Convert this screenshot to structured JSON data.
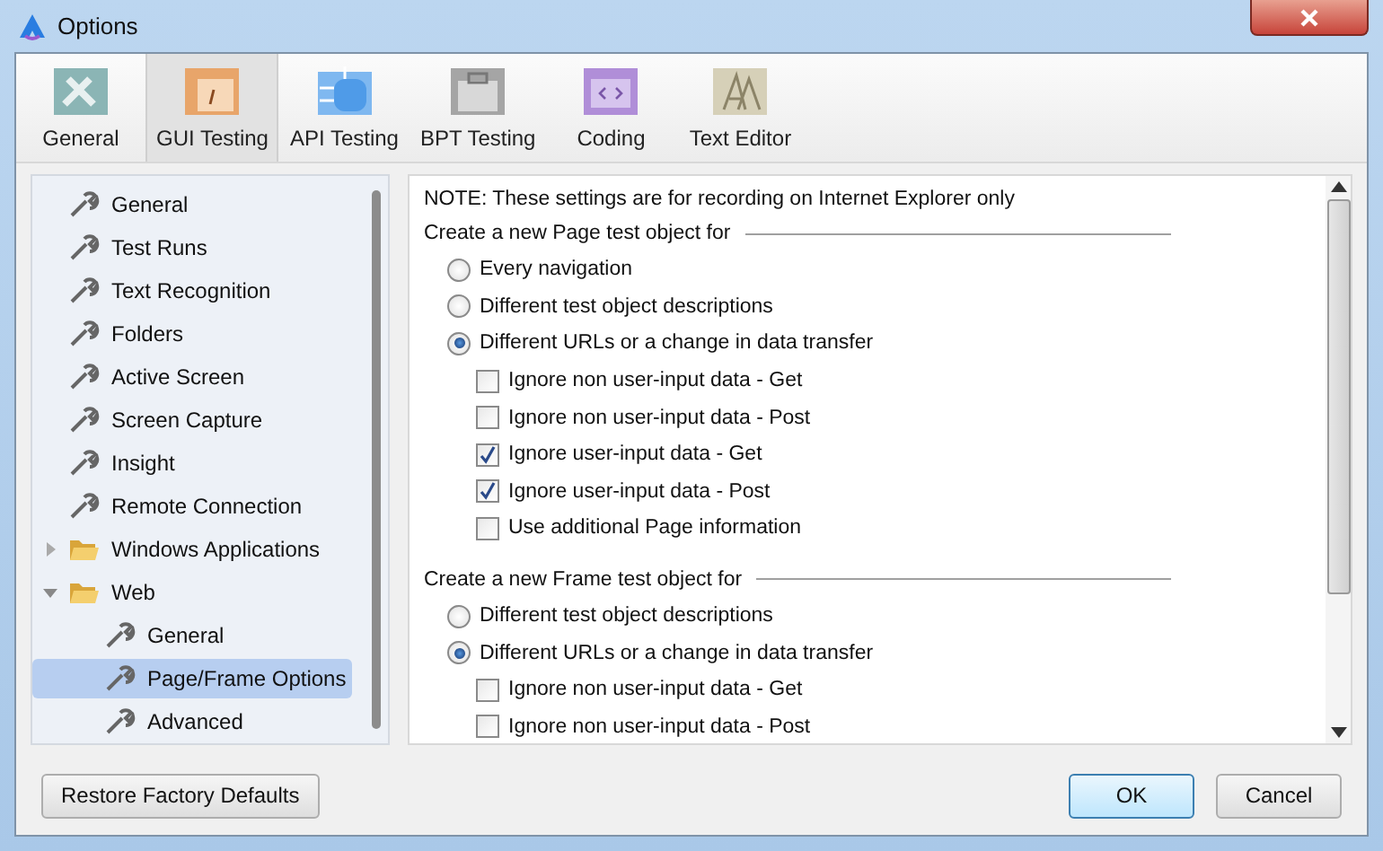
{
  "window": {
    "title": "Options"
  },
  "tabs": [
    {
      "label": "General",
      "selected": false
    },
    {
      "label": "GUI Testing",
      "selected": true
    },
    {
      "label": "API Testing",
      "selected": false
    },
    {
      "label": "BPT Testing",
      "selected": false
    },
    {
      "label": "Coding",
      "selected": false
    },
    {
      "label": "Text Editor",
      "selected": false
    }
  ],
  "tree": [
    {
      "label": "General",
      "kind": "leaf",
      "selected": false
    },
    {
      "label": "Test Runs",
      "kind": "leaf",
      "selected": false
    },
    {
      "label": "Text Recognition",
      "kind": "leaf",
      "selected": false
    },
    {
      "label": "Folders",
      "kind": "leaf",
      "selected": false
    },
    {
      "label": "Active Screen",
      "kind": "leaf",
      "selected": false
    },
    {
      "label": "Screen Capture",
      "kind": "leaf",
      "selected": false
    },
    {
      "label": "Insight",
      "kind": "leaf",
      "selected": false
    },
    {
      "label": "Remote Connection",
      "kind": "leaf",
      "selected": false
    },
    {
      "label": "Windows Applications",
      "kind": "folder",
      "expanded": false,
      "selected": false
    },
    {
      "label": "Web",
      "kind": "folder",
      "expanded": true,
      "selected": false,
      "children": [
        {
          "label": "General",
          "selected": false
        },
        {
          "label": "Page/Frame Options",
          "selected": true
        },
        {
          "label": "Advanced",
          "selected": false
        }
      ]
    }
  ],
  "content": {
    "note": "NOTE: These settings are for recording on Internet Explorer only",
    "groups": [
      {
        "title": "Create a new Page test object for",
        "items": [
          {
            "kind": "radio",
            "label": "Every navigation",
            "checked": false
          },
          {
            "kind": "radio",
            "label": "Different test object descriptions",
            "checked": false
          },
          {
            "kind": "radio",
            "label": "Different URLs or a change in data transfer",
            "checked": true
          },
          {
            "kind": "checkbox",
            "label": "Ignore non user-input data - Get",
            "checked": false
          },
          {
            "kind": "checkbox",
            "label": "Ignore non user-input data - Post",
            "checked": false
          },
          {
            "kind": "checkbox",
            "label": "Ignore user-input data - Get",
            "checked": true
          },
          {
            "kind": "checkbox",
            "label": "Ignore user-input data - Post",
            "checked": true
          },
          {
            "kind": "checkbox",
            "label": "Use additional Page information",
            "checked": false
          }
        ]
      },
      {
        "title": "Create a new Frame test object for",
        "items": [
          {
            "kind": "radio",
            "label": "Different test object descriptions",
            "checked": false
          },
          {
            "kind": "radio",
            "label": "Different URLs or a change in data transfer",
            "checked": true
          },
          {
            "kind": "checkbox",
            "label": "Ignore non user-input data - Get",
            "checked": false
          },
          {
            "kind": "checkbox",
            "label": "Ignore non user-input data - Post",
            "checked": false
          }
        ]
      }
    ]
  },
  "buttons": {
    "restore": "Restore Factory Defaults",
    "ok": "OK",
    "cancel": "Cancel"
  }
}
